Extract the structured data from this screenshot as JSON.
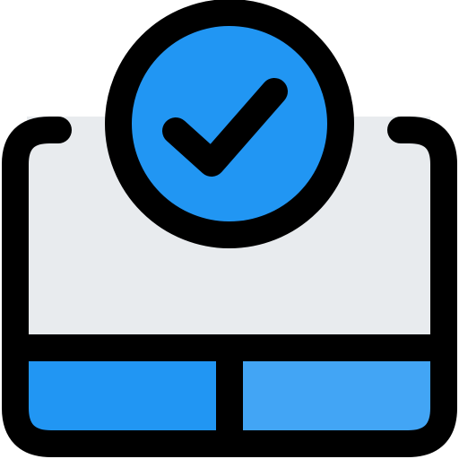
{
  "icon": {
    "name": "trackpad-check-icon",
    "colors": {
      "outline": "#000000",
      "surface": "#E8EBEE",
      "button_left": "#2196F3",
      "button_right": "#42A5F5",
      "badge": "#2196F3"
    }
  }
}
